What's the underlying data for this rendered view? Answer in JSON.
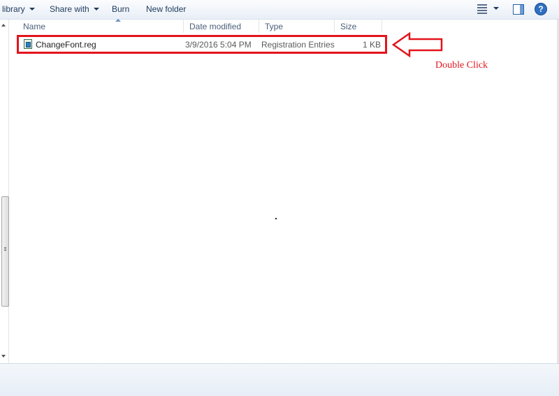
{
  "toolbar": {
    "library_label": "library",
    "share_label": "Share with",
    "burn_label": "Burn",
    "new_folder_label": "New folder",
    "help_glyph": "?"
  },
  "columns": {
    "name": "Name",
    "date": "Date modified",
    "type": "Type",
    "size": "Size"
  },
  "files": [
    {
      "name": "ChangeFont.reg",
      "date": "3/9/2016 5:04 PM",
      "type": "Registration Entries",
      "size": "1 KB",
      "icon": "registry-file-icon"
    }
  ],
  "annotation": {
    "text": "Double Click",
    "color": "#e3141c"
  },
  "icons": {
    "views": "views-icon",
    "preview_pane": "preview-pane-icon",
    "help": "help-icon"
  }
}
